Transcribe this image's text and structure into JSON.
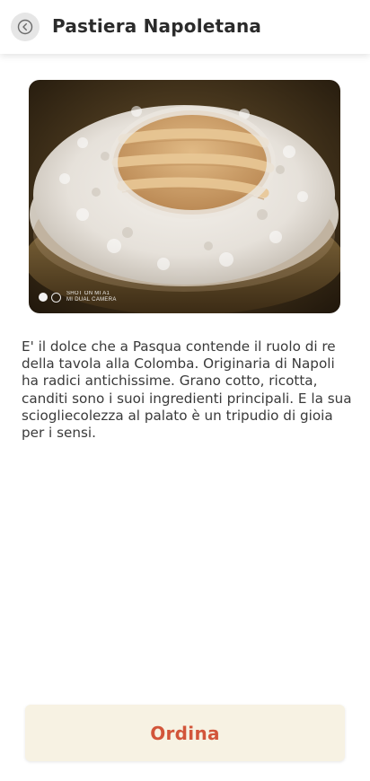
{
  "header": {
    "title": "Pastiera Napoletana",
    "back_icon": "chevron-left-circle-icon"
  },
  "photo": {
    "watermark_line1": "SHOT ON MI A1",
    "watermark_line2": "MI DUAL CAMERA"
  },
  "description": "E' il dolce che a Pasqua contende il ruolo di re della tavola alla Colomba. Originaria di Napoli ha radici antichissime. Grano cotto, ricotta, canditi sono i suoi ingredienti principali. E la sua sciogliecolezza al palato è un tripudio di gioia per i sensi.",
  "order_button": {
    "label": "Ordina"
  },
  "colors": {
    "accent": "#d2553a",
    "button_bg": "#f7f2e3",
    "header_bg": "#ffffff"
  }
}
